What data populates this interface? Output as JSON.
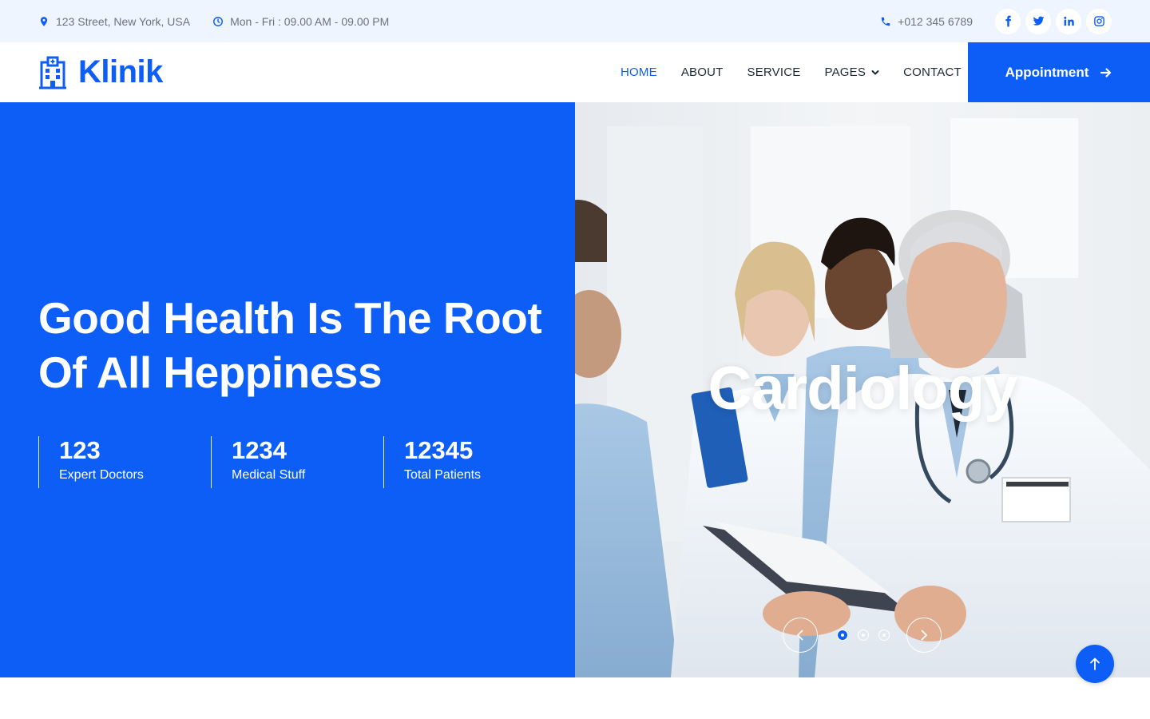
{
  "topbar": {
    "address": "123 Street, New York, USA",
    "hours": "Mon - Fri : 09.00 AM - 09.00 PM",
    "phone": "+012 345 6789",
    "social": [
      {
        "icon": "facebook-icon",
        "glyph": "f"
      },
      {
        "icon": "twitter-icon",
        "glyph": "t"
      },
      {
        "icon": "linkedin-icon",
        "glyph": "in"
      },
      {
        "icon": "instagram-icon",
        "glyph": "ig"
      }
    ]
  },
  "navbar": {
    "brand": "Klinik",
    "brand_icon": "hospital-icon",
    "items": [
      {
        "label": "HOME",
        "active": true
      },
      {
        "label": "ABOUT"
      },
      {
        "label": "SERVICE"
      },
      {
        "label": "PAGES",
        "dropdown": true
      },
      {
        "label": "CONTACT"
      }
    ],
    "cta": "Appointment"
  },
  "hero": {
    "title_line1": "Good Health Is The Root",
    "title_line2": "Of All Heppiness",
    "stats": [
      {
        "number": "123",
        "label": "Expert Doctors"
      },
      {
        "number": "1234",
        "label": "Medical Stuff"
      },
      {
        "number": "12345",
        "label": "Total Patients"
      }
    ],
    "slide_title": "Cardiology",
    "slide_dots": 3,
    "active_slide": 1
  },
  "colors": {
    "primary": "#0d5ef6",
    "topbar_bg": "#eff5ff",
    "text_muted": "#6b7280"
  }
}
